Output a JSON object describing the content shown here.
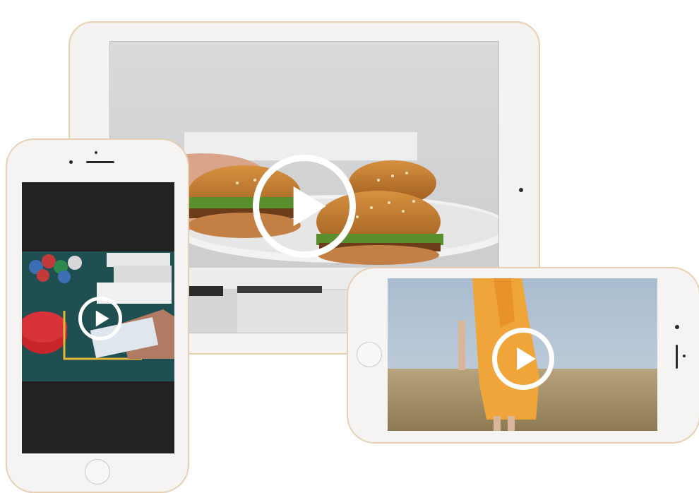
{
  "devices": {
    "tablet": {
      "video": {
        "subject": "burger-photo",
        "play_icon": "play-icon"
      },
      "colors": {
        "frame": "#f4f3f1",
        "bezel_edge": "#e7d2b8"
      }
    },
    "phone_portrait": {
      "video": {
        "subject": "casino-cards-photo",
        "play_icon": "play-icon"
      }
    },
    "phone_landscape": {
      "video": {
        "subject": "field-dress-photo",
        "play_icon": "play-icon"
      }
    }
  },
  "colors": {
    "play_button": "#ffffff",
    "device_gold": "#e6cfb3"
  }
}
